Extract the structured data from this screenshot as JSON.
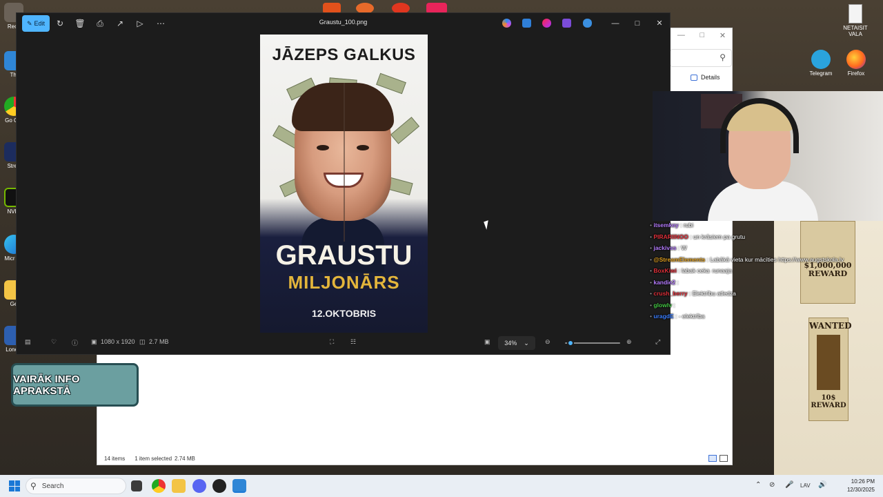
{
  "desktop": {
    "left_icons": [
      "Recy",
      "Thi",
      "Go Chr",
      "Strea",
      "NVID",
      "Micr Ed",
      "Ge",
      "Lonely"
    ],
    "right_icons": [
      {
        "label": "NETAISIT VALA",
        "icon": "document-icon"
      },
      {
        "label": "Telegram",
        "icon": "telegram-icon"
      },
      {
        "label": "Firefox",
        "icon": "firefox-icon"
      }
    ]
  },
  "explorer": {
    "details_label": "Details",
    "status": {
      "items": "14 items",
      "selected": "1 item selected",
      "size": "2.74 MB"
    }
  },
  "photos": {
    "edit_label": "Edit",
    "filename": "Graustu_100.png",
    "bottom": {
      "dimensions": "1080 x 1920",
      "filesize": "2.7 MB",
      "zoom": "34%",
      "zoom_fraction": 0.1
    }
  },
  "poster": {
    "author": "JĀZEPS GALKUS",
    "title": "GRAUSTU",
    "subtitle": "MILJONĀRS",
    "date": "12.OKTOBRIS"
  },
  "chat": [
    {
      "name": "itsemkey",
      "text": " : rubi",
      "color": "#b57cff"
    },
    {
      "name": "PIRARIINOO",
      "text": " : un krāsiem pa grutu",
      "color": "#e0303a"
    },
    {
      "name": "jackivss",
      "text": " : W",
      "color": "#b57cff"
    },
    {
      "name": "@StreamElements",
      "text": " : Labākā vieta kur mācīties https://www.augstskola.lv",
      "color": "#e0a020"
    },
    {
      "name": "BoxKiwi",
      "text": " : labak ceka",
      "color": "#e0303a",
      "extra": "runaaja"
    },
    {
      "name": "kandie2",
      "text": " :",
      "color": "#b57cff"
    },
    {
      "name": "crush_berry",
      "text": " : Elektrību atledza",
      "color": "#e0303a"
    },
    {
      "name": "glowlv",
      "text": " :",
      "color": "#44c744"
    },
    {
      "name": "uragdE",
      "text": " : - elektrība",
      "color": "#3a7dff"
    }
  ],
  "wall_posters": [
    {
      "top": "$1,000,000",
      "bottom": "REWARD"
    },
    {
      "top": "WANTED",
      "bottom": "10$ REWARD"
    }
  ],
  "info_badge": "VAIRĀK INFO APRAKSTĀ",
  "taskbar": {
    "search_placeholder": "Search",
    "lang": "LAV",
    "time": "10:26 PM",
    "date": "12/30/2025"
  }
}
